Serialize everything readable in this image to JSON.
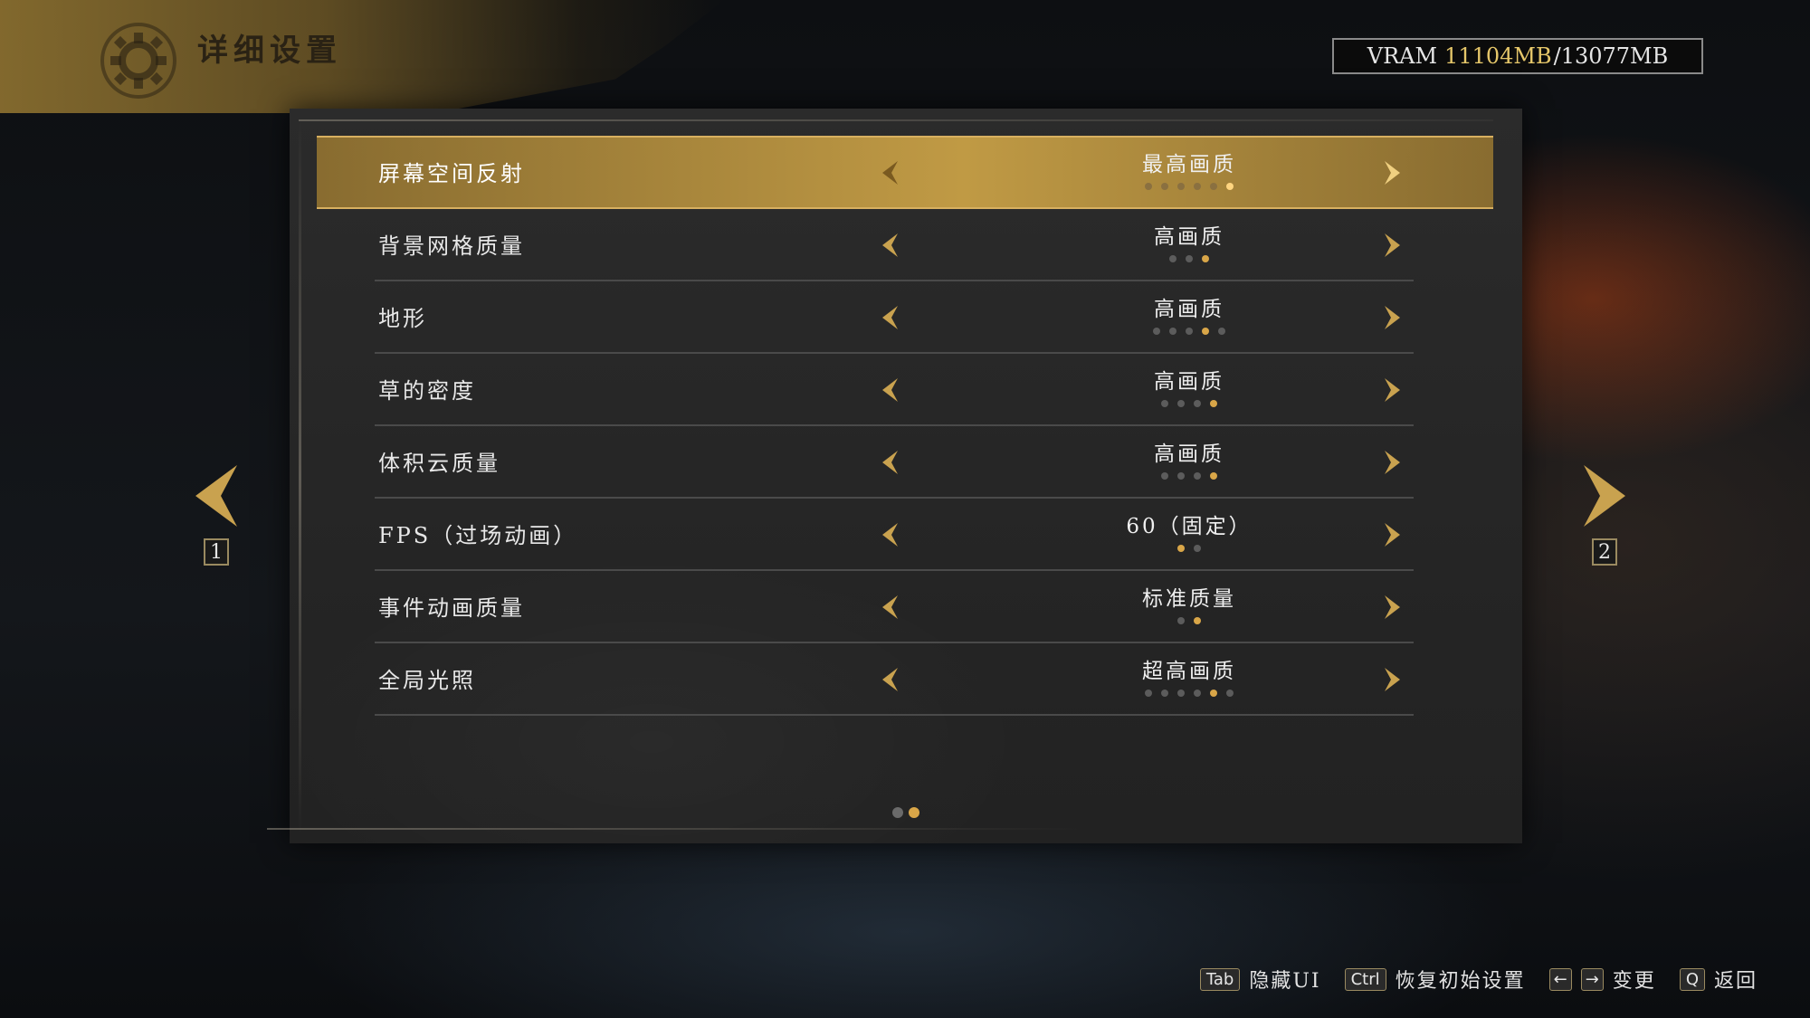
{
  "header": {
    "title": "详细设置",
    "icon": "gear-icon"
  },
  "vram": {
    "prefix": "VRAM",
    "used": "11104MB",
    "total": "/13077MB"
  },
  "settings": [
    {
      "label": "屏幕空间反射",
      "value": "最高画质",
      "dots": 6,
      "active": 5,
      "selected": true
    },
    {
      "label": "背景网格质量",
      "value": "高画质",
      "dots": 3,
      "active": 2
    },
    {
      "label": "地形",
      "value": "高画质",
      "dots": 5,
      "active": 3
    },
    {
      "label": "草的密度",
      "value": "高画质",
      "dots": 4,
      "active": 3
    },
    {
      "label": "体积云质量",
      "value": "高画质",
      "dots": 4,
      "active": 3
    },
    {
      "label": "FPS（过场动画）",
      "value": "60（固定）",
      "dots": 2,
      "active": 0
    },
    {
      "label": "事件动画质量",
      "value": "标准质量",
      "dots": 2,
      "active": 1
    },
    {
      "label": "全局光照",
      "value": "超高画质",
      "dots": 6,
      "active": 4
    }
  ],
  "pagination": {
    "prev_page": "1",
    "next_page": "2",
    "total": 2,
    "current": 2
  },
  "footer": [
    {
      "key": "Tab",
      "label": "隐藏UI"
    },
    {
      "key": "Ctrl",
      "label": "恢复初始设置"
    },
    {
      "keys": [
        "←",
        "→"
      ],
      "label": "变更"
    },
    {
      "key": "Q",
      "label": "返回"
    }
  ],
  "colors": {
    "accent": "#d9a648",
    "selected_row": "#c8a046",
    "panel": "#262626"
  }
}
